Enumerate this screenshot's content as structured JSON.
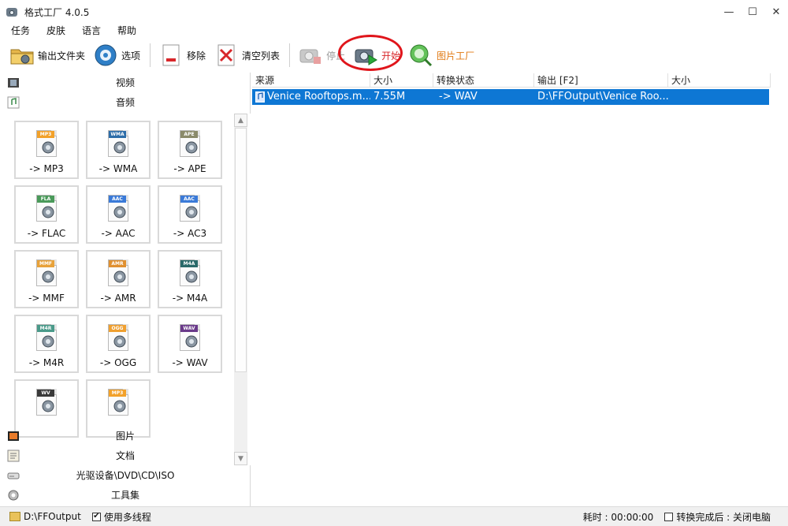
{
  "window": {
    "title": "格式工厂 4.0.5",
    "minimize": "—",
    "maximize": "☐",
    "close": "✕"
  },
  "menu": [
    {
      "label": "任务"
    },
    {
      "label": "皮肤"
    },
    {
      "label": "语言"
    },
    {
      "label": "帮助"
    }
  ],
  "toolbar": {
    "output_folder": "输出文件夹",
    "options": "选项",
    "remove": "移除",
    "clear_list": "清空列表",
    "stop": "停止",
    "start": "开始",
    "picture_factory": "图片工厂"
  },
  "categories": {
    "video": "视频",
    "audio": "音频",
    "picture": "图片",
    "document": "文档",
    "rom": "光驱设备\\DVD\\CD\\ISO",
    "tools": "工具集"
  },
  "audio_tiles": [
    {
      "label": "-> MP3",
      "badge": "MP3",
      "badge_color": "#f2a12a"
    },
    {
      "label": "-> WMA",
      "badge": "WMA",
      "badge_color": "#2d6da8"
    },
    {
      "label": "-> APE",
      "badge": "APE",
      "badge_color": "#8a8a6a"
    },
    {
      "label": "-> FLAC",
      "badge": "FLA",
      "badge_color": "#4a9a5a"
    },
    {
      "label": "-> AAC",
      "badge": "AAC",
      "badge_color": "#3a7ad8"
    },
    {
      "label": "-> AC3",
      "badge": "AAC",
      "badge_color": "#3a7ad8"
    },
    {
      "label": "-> MMF",
      "badge": "MMF",
      "badge_color": "#e8a23a"
    },
    {
      "label": "-> AMR",
      "badge": "AMR",
      "badge_color": "#e09030"
    },
    {
      "label": "-> M4A",
      "badge": "M4A",
      "badge_color": "#2a6a6a"
    },
    {
      "label": "-> M4R",
      "badge": "M4R",
      "badge_color": "#4a9a8a"
    },
    {
      "label": "-> OGG",
      "badge": "OGG",
      "badge_color": "#f0a030"
    },
    {
      "label": "-> WAV",
      "badge": "WAV",
      "badge_color": "#6a3a8a"
    },
    {
      "label": "",
      "badge": "WV",
      "badge_color": "#3a3a3a"
    },
    {
      "label": "",
      "badge": "MP3",
      "badge_color": "#f2a12a"
    }
  ],
  "table": {
    "headers": [
      "来源",
      "大小",
      "转换状态",
      "输出 [F2]",
      "大小"
    ],
    "rows": [
      {
        "source": "Venice Rooftops.m...",
        "size": "7.55M",
        "status": "-> WAV",
        "output": "D:\\FFOutput\\Venice Roo...",
        "out_size": ""
      }
    ]
  },
  "status": {
    "output_path": "D:\\FFOutput",
    "multithread_label": "使用多线程",
    "multithread_checked": "✔",
    "elapsed": "耗时 : 00:00:00",
    "after_convert": "转换完成后 : 关闭电脑"
  },
  "colors": {
    "selection": "#0e77d4",
    "highlight_ring": "#e0151b"
  }
}
